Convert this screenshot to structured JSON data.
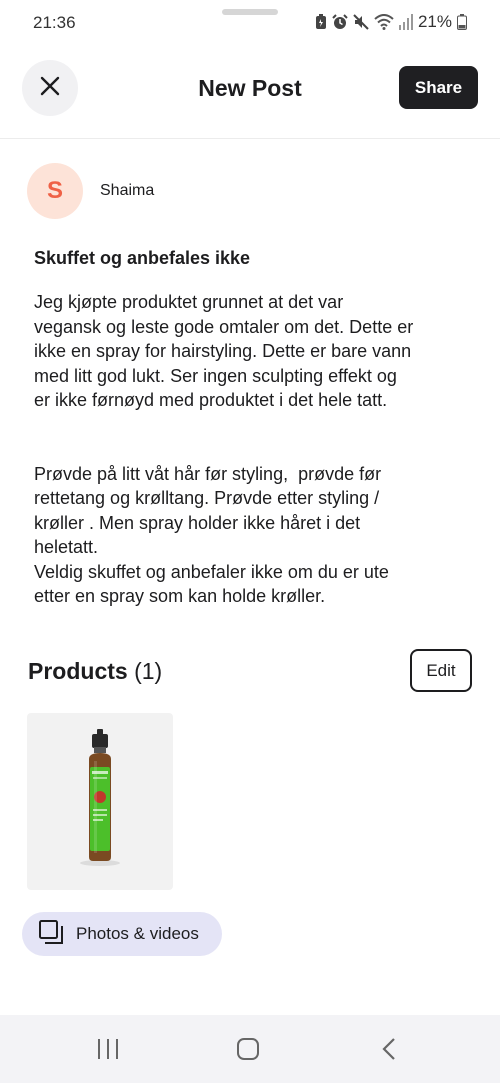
{
  "status_bar": {
    "time": "21:36",
    "battery": "21%",
    "icons": [
      "battery-saver-icon",
      "alarm-icon",
      "mute-icon",
      "wifi-icon",
      "signal-icon",
      "battery-icon"
    ]
  },
  "header": {
    "title": "New Post",
    "share_label": "Share",
    "close_icon": "close-icon"
  },
  "author": {
    "initial": "S",
    "name": "Shaima",
    "avatar_bg": "#fde3d8",
    "avatar_fg": "#ef6146"
  },
  "post": {
    "title": "Skuffet og anbefales ikke",
    "body": "Jeg kjøpte produktet grunnet at det var\nvegansk og leste gode omtaler om det. Dette er\nikke en spray for hairstyling. Dette er bare vann\nmed litt god lukt. Ser ingen sculpting effekt og\ner ikke førnøyd med produktet i det hele tatt.\n\n\nPrøvde på litt våt hår før styling,  prøvde før\nrettetang og krølltang. Prøvde etter styling /\nkrøller . Men spray holder ikke håret i det\nheletatt.\nVeldig skuffet og anbefaler ikke om du er ute\netter en spray som kan holde krøller."
  },
  "products": {
    "heading": "Products",
    "count": "(1)",
    "edit_label": "Edit"
  },
  "media": {
    "label": "Photos & videos"
  },
  "colors": {
    "accent_dark": "#1f1f22",
    "media_button_bg": "#e4e4f6",
    "nav_bar_bg": "#f3f3f6"
  }
}
